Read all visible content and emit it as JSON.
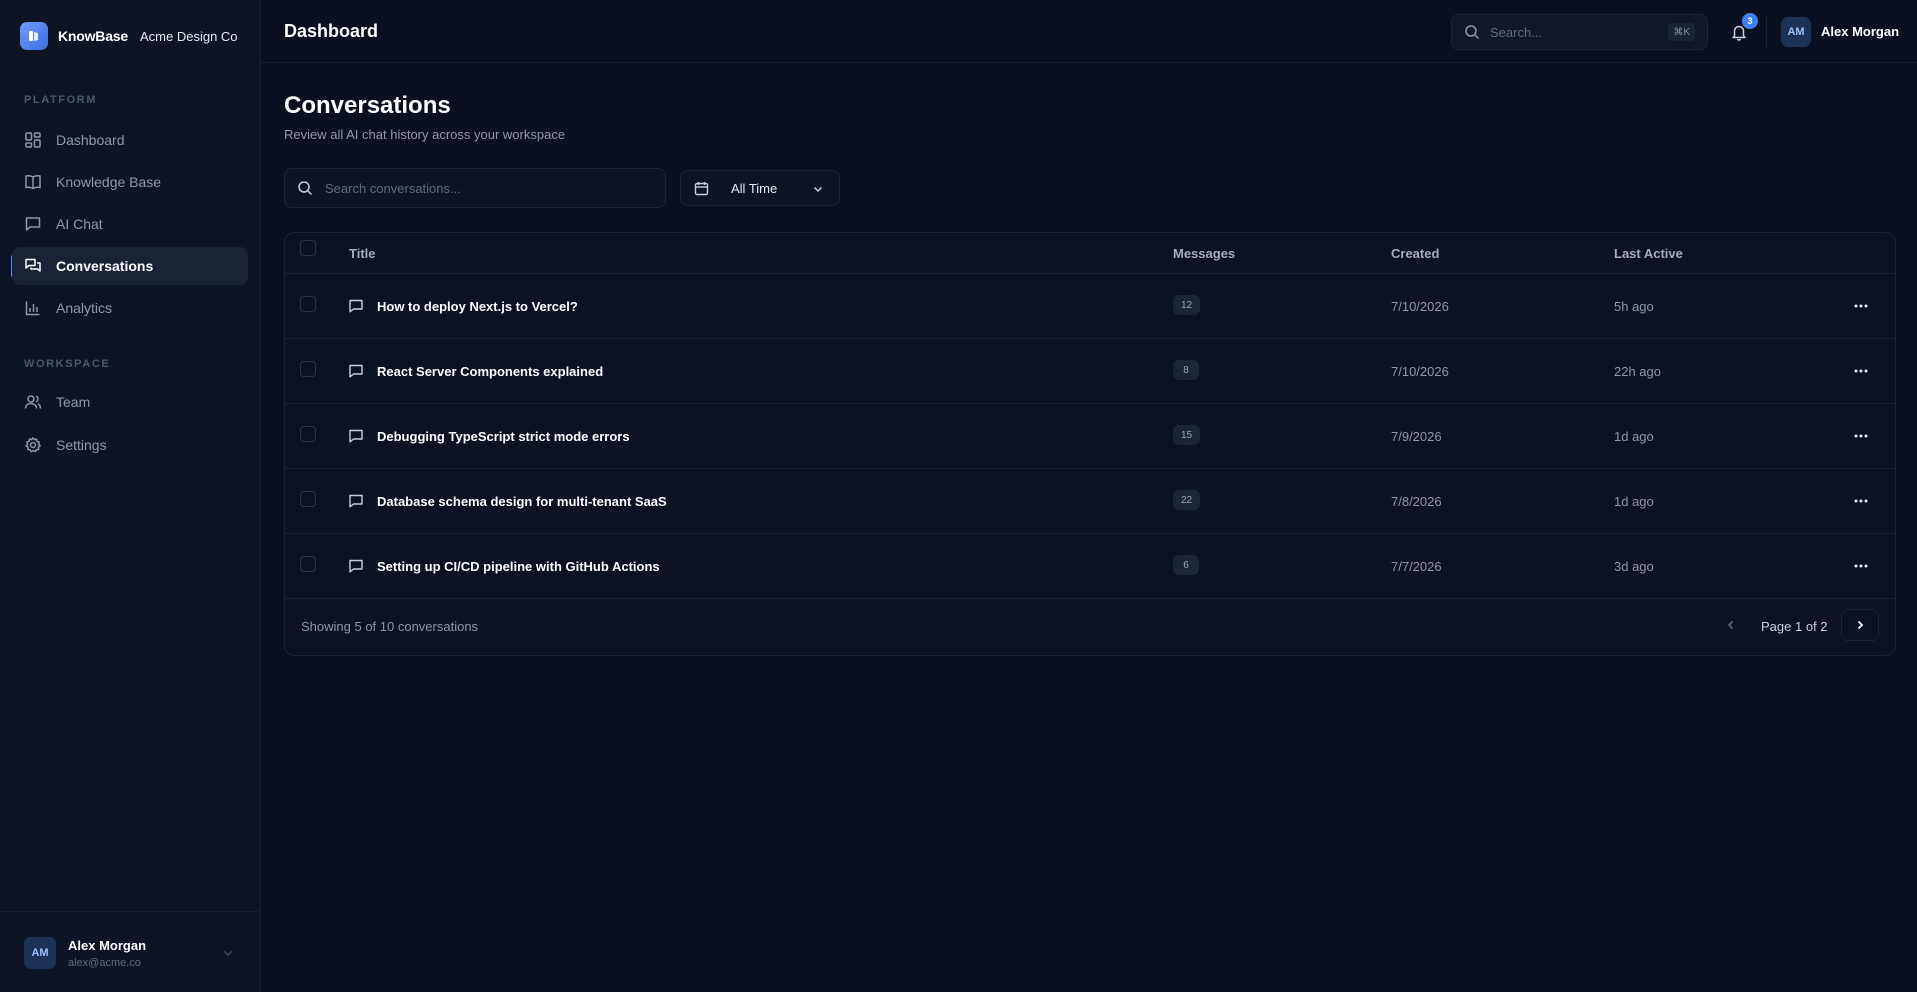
{
  "brand": {
    "name": "KnowBase",
    "org": "Acme Design Co"
  },
  "sidebar": {
    "platform_label": "PLATFORM",
    "workspace_label": "WORKSPACE",
    "platform_items": [
      {
        "label": "Dashboard",
        "icon": "grid-icon"
      },
      {
        "label": "Knowledge Base",
        "icon": "book-icon"
      },
      {
        "label": "AI Chat",
        "icon": "message-icon"
      },
      {
        "label": "Conversations",
        "icon": "messages-icon",
        "active": true
      },
      {
        "label": "Analytics",
        "icon": "bar-chart-icon"
      }
    ],
    "workspace_items": [
      {
        "label": "Team",
        "icon": "users-icon"
      },
      {
        "label": "Settings",
        "icon": "gear-icon"
      }
    ],
    "user": {
      "initials": "AM",
      "name": "Alex Morgan",
      "email": "alex@acme.co"
    }
  },
  "header": {
    "title": "Dashboard",
    "search_placeholder": "Search...",
    "search_shortcut": "⌘K",
    "notification_count": "3",
    "user_initials": "AM",
    "user_name": "Alex Morgan"
  },
  "main": {
    "title": "Conversations",
    "subtitle": "Review all AI chat history across your workspace",
    "search_placeholder": "Search conversations...",
    "time_filter": "All Time",
    "columns": {
      "title": "Title",
      "messages": "Messages",
      "created": "Created",
      "last_active": "Last Active"
    },
    "rows": [
      {
        "title": "How to deploy Next.js to Vercel?",
        "messages": "12",
        "created": "7/10/2026",
        "last_active": "5h ago"
      },
      {
        "title": "React Server Components explained",
        "messages": "8",
        "created": "7/10/2026",
        "last_active": "22h ago"
      },
      {
        "title": "Debugging TypeScript strict mode errors",
        "messages": "15",
        "created": "7/9/2026",
        "last_active": "1d ago"
      },
      {
        "title": "Database schema design for multi-tenant SaaS",
        "messages": "22",
        "created": "7/8/2026",
        "last_active": "1d ago"
      },
      {
        "title": "Setting up CI/CD pipeline with GitHub Actions",
        "messages": "6",
        "created": "7/7/2026",
        "last_active": "3d ago"
      }
    ],
    "showing_text": "Showing 5 of 10 conversations",
    "page_label": "Page 1 of 2"
  },
  "colors": {
    "accent": "#3b82f6",
    "background": "#0a1020",
    "sidebar": "#0d1426"
  }
}
